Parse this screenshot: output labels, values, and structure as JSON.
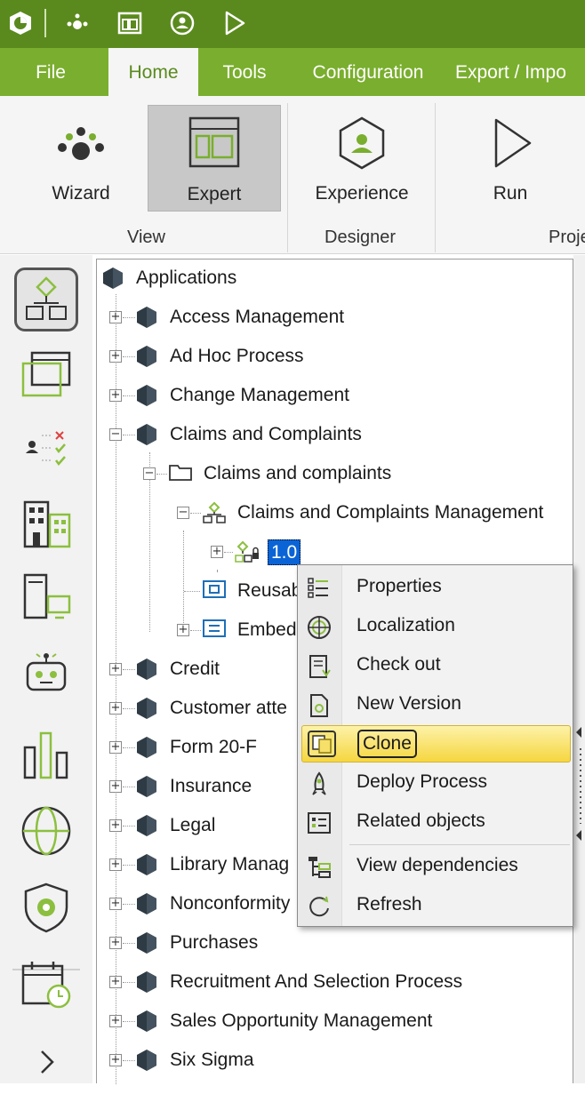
{
  "menu": {
    "tabs": [
      "File",
      "Home",
      "Tools",
      "Configuration",
      "Export / Impo"
    ],
    "active_tab": "Home"
  },
  "ribbon": {
    "buttons": {
      "wizard": "Wizard",
      "expert": "Expert",
      "experience": "Experience",
      "run": "Run"
    },
    "groups": {
      "view": "View",
      "designer": "Designer",
      "project": "Proje"
    }
  },
  "tree": {
    "root": "Applications",
    "items": [
      "Access Management",
      "Ad Hoc Process",
      "Change Management",
      "Claims and Complaints",
      "Claims and complaints",
      "Claims and Complaints Management",
      "1.0",
      "Reusab",
      "Embed",
      "Credit",
      "Customer atte",
      "Form 20-F",
      "Insurance",
      "Legal",
      "Library Manag",
      "Nonconformity",
      "Purchases",
      "Recruitment And Selection Process",
      "Sales Opportunity Management",
      "Six Sigma"
    ]
  },
  "context_menu": {
    "items": [
      "Properties",
      "Localization",
      "Check out",
      "New Version",
      "Clone",
      "Deploy Process",
      "Related objects",
      "View dependencies",
      "Refresh"
    ],
    "highlighted": "Clone"
  },
  "colors": {
    "titlebar": "#5a8a1d",
    "menubar": "#7aae2e",
    "selection": "#0a64d6",
    "highlight": "#f6d640",
    "icon_green": "#8cbf3f"
  }
}
